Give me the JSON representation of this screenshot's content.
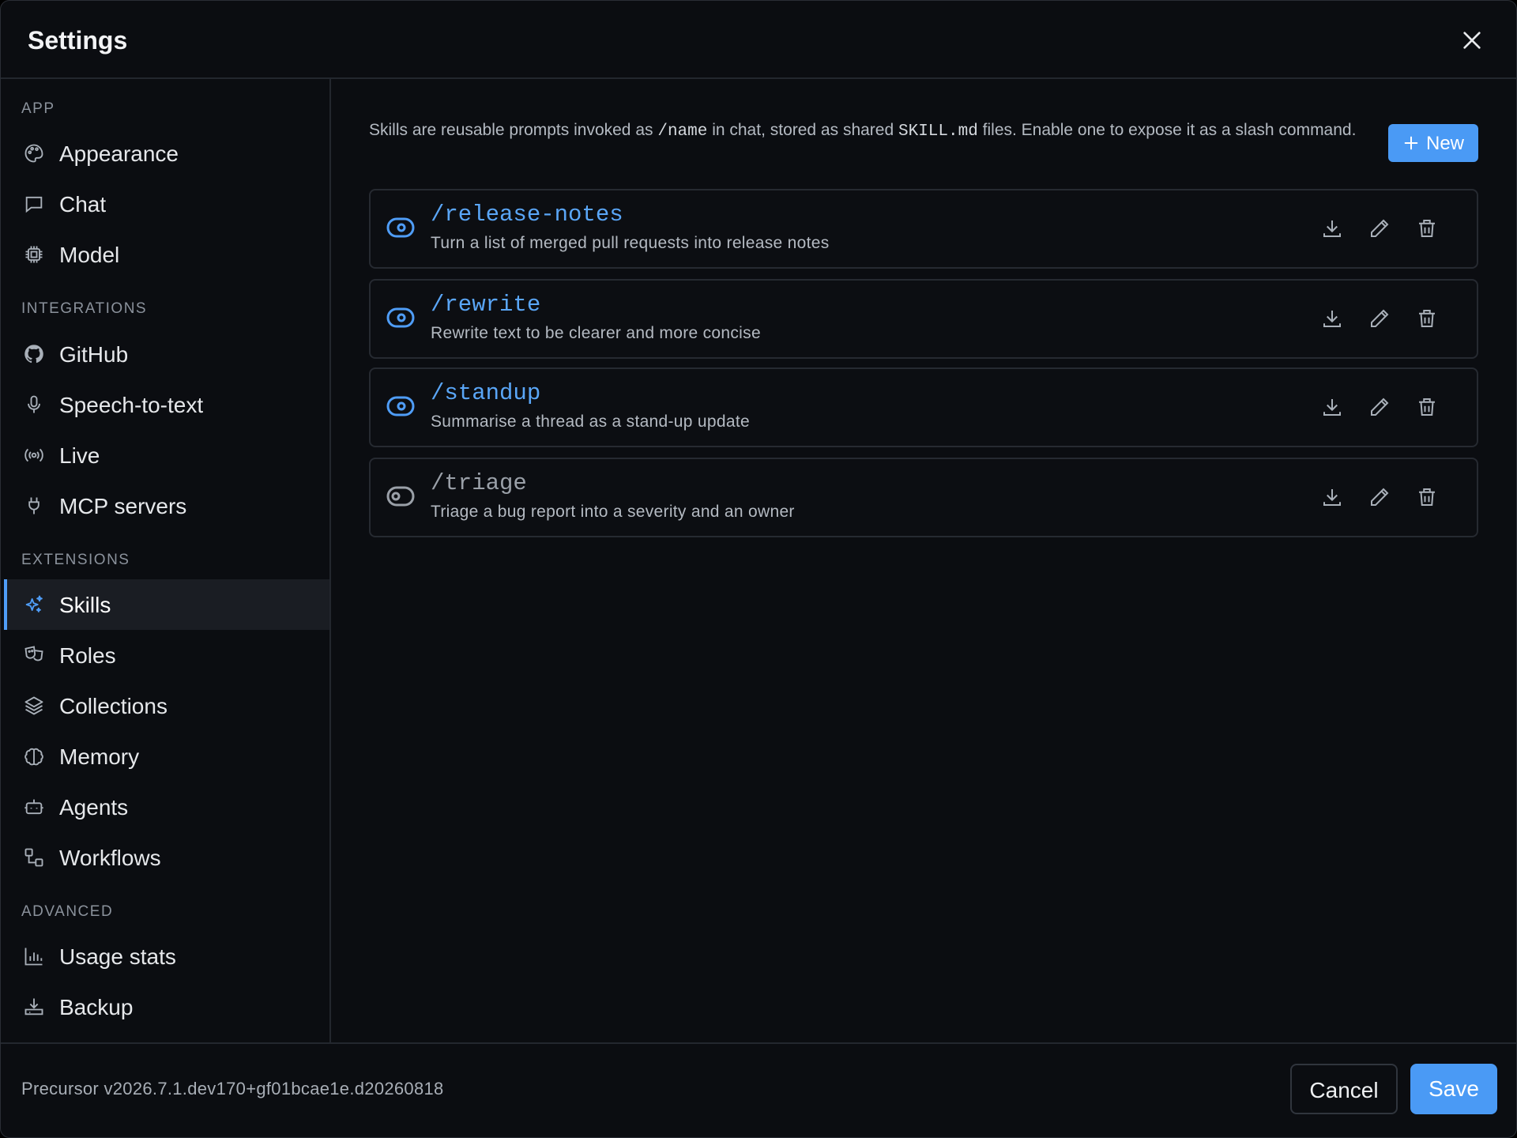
{
  "window": {
    "title": "Settings"
  },
  "sidebar": {
    "sections": [
      {
        "label": "APP",
        "items": [
          {
            "label": "Appearance",
            "icon": "palette-icon"
          },
          {
            "label": "Chat",
            "icon": "chat-bubble-icon"
          },
          {
            "label": "Model",
            "icon": "cpu-chip-icon"
          }
        ]
      },
      {
        "label": "INTEGRATIONS",
        "items": [
          {
            "label": "GitHub",
            "icon": "github-icon"
          },
          {
            "label": "Speech-to-text",
            "icon": "microphone-icon"
          },
          {
            "label": "Live",
            "icon": "broadcast-icon"
          },
          {
            "label": "MCP servers",
            "icon": "plug-icon"
          }
        ]
      },
      {
        "label": "EXTENSIONS",
        "items": [
          {
            "label": "Skills",
            "icon": "sparkles-icon",
            "active": true
          },
          {
            "label": "Roles",
            "icon": "theater-masks-icon"
          },
          {
            "label": "Collections",
            "icon": "layers-icon"
          },
          {
            "label": "Memory",
            "icon": "brain-icon"
          },
          {
            "label": "Agents",
            "icon": "robot-icon"
          },
          {
            "label": "Workflows",
            "icon": "workflow-icon"
          }
        ]
      },
      {
        "label": "ADVANCED",
        "items": [
          {
            "label": "Usage stats",
            "icon": "bar-chart-icon"
          },
          {
            "label": "Backup",
            "icon": "download-tray-icon"
          }
        ]
      }
    ]
  },
  "main": {
    "description": {
      "part1": "Skills are reusable prompts invoked as ",
      "code1": "/name",
      "part2": " in chat, stored as shared ",
      "code2": "SKILL.md",
      "part3": " files. Enable one to expose it as a slash command."
    },
    "new_button": "New",
    "skills": [
      {
        "name": "/release-notes",
        "description": "Turn a list of merged pull requests into release notes",
        "enabled": true
      },
      {
        "name": "/rewrite",
        "description": "Rewrite text to be clearer and more concise",
        "enabled": true
      },
      {
        "name": "/standup",
        "description": "Summarise a thread as a stand-up update",
        "enabled": true
      },
      {
        "name": "/triage",
        "description": "Triage a bug report into a severity and an owner",
        "enabled": false
      }
    ]
  },
  "footer": {
    "version": "Precursor v2026.7.1.dev170+gf01bcae1e.d20260818",
    "cancel_label": "Cancel",
    "save_label": "Save"
  },
  "colors": {
    "accent": "#4a9af5",
    "background": "#0b0d11",
    "border": "#262a31"
  }
}
